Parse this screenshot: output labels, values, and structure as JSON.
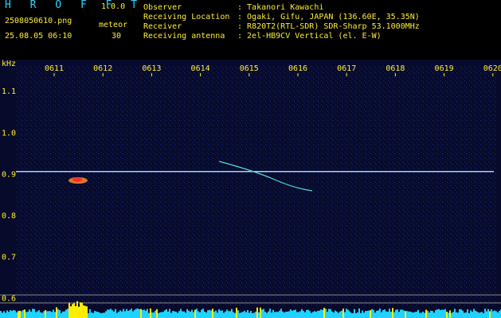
{
  "header": {
    "app_title": "H R O F F T",
    "app_version": "1.0.0",
    "filename": "2508050610.png",
    "meteor_label": "meteor",
    "timestamp": "25.08.05 06:10",
    "meteor_count": "30",
    "info": [
      {
        "key": "Observer",
        "value": ": Takanori Kawachi"
      },
      {
        "key": "Receiving Location",
        "value": ": Ogaki, Gifu, JAPAN (136.60E, 35.35N)"
      },
      {
        "key": "Receiver",
        "value": ": R820T2(RTL-SDR) SDR-Sharp 53.1000MHz"
      },
      {
        "key": "Receiving antenna",
        "value": ": 2el-HB9CV Vertical (el. E-W)"
      }
    ]
  },
  "chart_data": {
    "type": "heatmap",
    "ylabel": "kHz",
    "y_ticks": [
      "1.1",
      "1.0",
      "0.9",
      "0.8",
      "0.7",
      "0.6"
    ],
    "x_ticks": [
      "0611",
      "0612",
      "0613",
      "0614",
      "0615",
      "0616",
      "0617",
      "0618",
      "0619",
      "0620"
    ],
    "ylim": [
      0.58,
      1.16
    ],
    "carrier_khz": 0.905,
    "colors": {
      "background": "#070a2a",
      "carrier": "#9fd8ff",
      "axis_text": "#ffee33",
      "title": "#23d8ff"
    }
  }
}
